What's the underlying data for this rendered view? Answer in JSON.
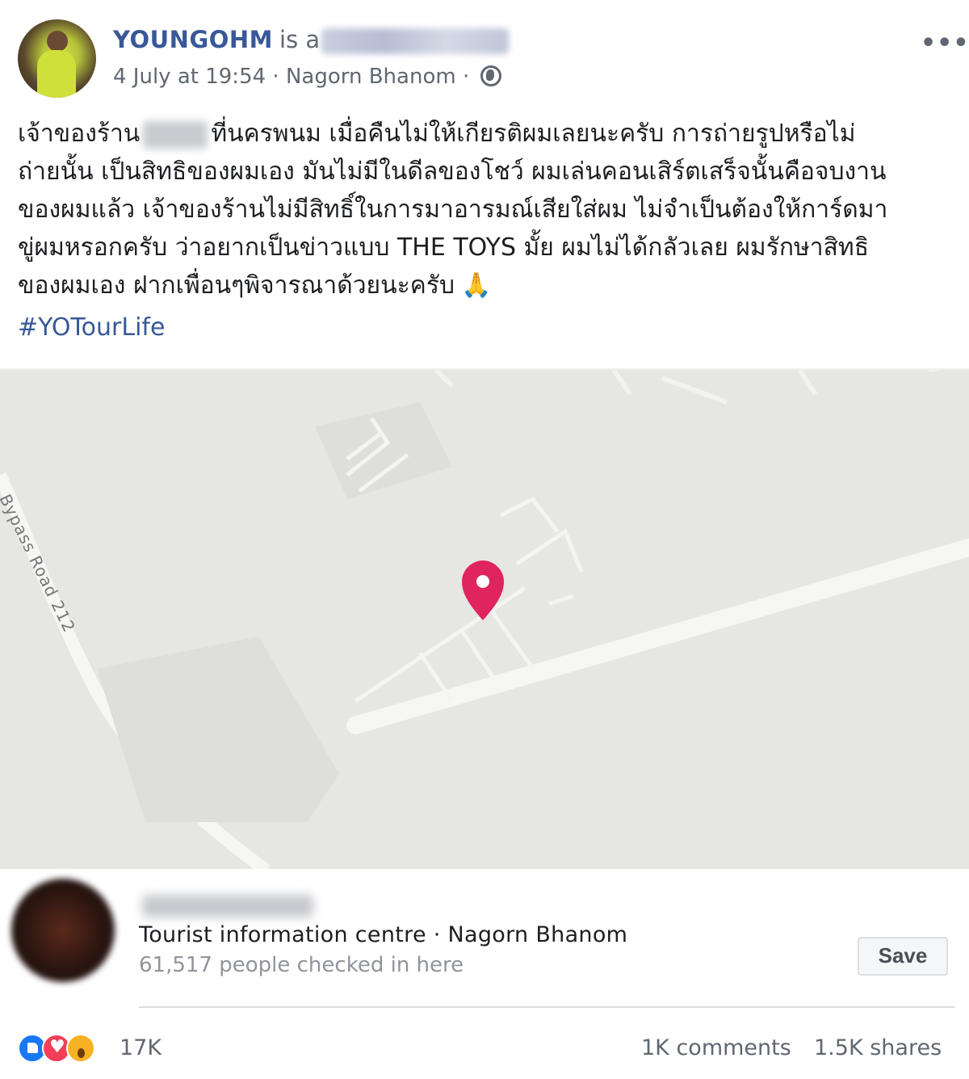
{
  "post": {
    "author": "YOUNGOHM",
    "is_a": "is a",
    "timestamp": "4 July at 19:54",
    "separator": " · ",
    "location": "Nagorn Bhanom",
    "audience_icon": "globe-icon",
    "more_icon": "more-options-icon",
    "more_label": "•••",
    "text_lines": [
      {
        "before": "เจ้าของร้าน",
        "after": "ที่นครพนม เมื่อคืนไม่ให้เกียรติผมเลยนะครับ การถ่ายรูปหรือไม่"
      },
      {
        "text": "ถ่ายนั้น เป็นสิทธิของผมเอง มันไม่มีในดีลของโชว์ ผมเล่นคอนเสิร์ตเสร็จนั้นคือจบงาน"
      },
      {
        "text": "ของผมแล้ว เจ้าของร้านไม่มีสิทธิ์ในการมาอารมณ์เสียใส่ผม ไม่จำเป็นต้องให้การ์ดมา"
      },
      {
        "text": "ขู่ผมหรอกครับ ว่าอยากเป็นข่าวแบบ THE TOYS มั้ย ผมไม่ได้กลัวเลย ผมรักษาสิทธิ"
      },
      {
        "text": "ของผมเอง ฝากเพื่อนๆพิจารณาด้วยนะครับ",
        "emoji": "🙏"
      }
    ],
    "hashtag": "#YOTourLife"
  },
  "map": {
    "road_label": "Bypass Road 212",
    "pin_icon": "location-pin-icon",
    "pin_color": "#e0245e"
  },
  "place": {
    "category_location": "Tourist information centre · Nagorn Bhanom",
    "checkins": "61,517 people checked in here",
    "save_label": "Save"
  },
  "footer": {
    "reaction_icons": [
      "like-icon",
      "love-icon",
      "wow-icon"
    ],
    "reaction_count": "17K",
    "comments": "1K comments",
    "shares": "1.5K shares"
  },
  "colors": {
    "link": "#385898",
    "secondary_text": "#606770",
    "map_bg": "#e6e6e5"
  }
}
